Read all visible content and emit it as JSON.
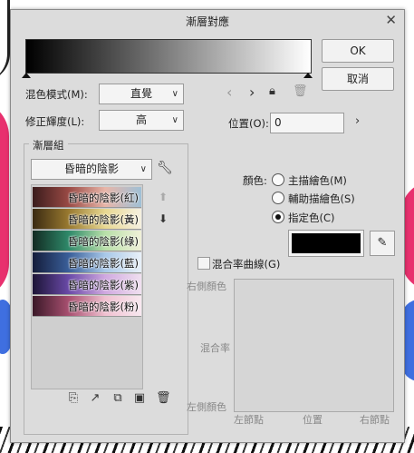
{
  "dialog": {
    "title": "漸層對應",
    "ok": "OK",
    "cancel": "取消"
  },
  "gradient": {
    "start_color": "#000000",
    "end_color": "#ffffff"
  },
  "blend_mode": {
    "label": "混色模式(M):",
    "value": "直覺"
  },
  "correction": {
    "label": "修正輝度(L):",
    "value": "高"
  },
  "position": {
    "label": "位置(O):",
    "value": "0"
  },
  "gradient_set": {
    "title": "漸層組",
    "selected": "昏暗的陰影",
    "items": [
      {
        "label": "昏暗的陰影(紅)",
        "colors": [
          "#3a1c1c",
          "#9a4a45",
          "#e8b5a8",
          "#9fc0d6"
        ]
      },
      {
        "label": "昏暗的陰影(黃)",
        "colors": [
          "#3a2a12",
          "#9a7a30",
          "#e8d890",
          "#f5f0e0"
        ]
      },
      {
        "label": "昏暗的陰影(綠)",
        "colors": [
          "#122a22",
          "#2f8a6a",
          "#b8e0a8",
          "#f0f0d8"
        ]
      },
      {
        "label": "昏暗的陰影(藍)",
        "colors": [
          "#141c3a",
          "#3a5f9a",
          "#a8c8e8",
          "#e8f0f8"
        ]
      },
      {
        "label": "昏暗的陰影(紫)",
        "colors": [
          "#1c1436",
          "#6a4aa8",
          "#d0a8e0",
          "#f0e0f0"
        ]
      },
      {
        "label": "昏暗的陰影(粉)",
        "colors": [
          "#3a1828",
          "#a85070",
          "#f0c0d0",
          "#f8e8f0"
        ]
      }
    ]
  },
  "color_section": {
    "label": "顏色:",
    "options": [
      "主描繪色(M)",
      "輔助描繪色(S)",
      "指定色(C)"
    ],
    "selected": 2,
    "swatch_color": "#000000"
  },
  "blend_curve": {
    "label": "混合率曲線(G)",
    "y_top": "右側顏色",
    "y_mid": "混合率",
    "y_bottom": "左側顏色",
    "x_left": "左節點",
    "x_mid": "位置",
    "x_right": "右節點"
  },
  "icons": {
    "close": "close-icon",
    "prev": "chevron-left-icon",
    "next": "chevron-right-icon",
    "lock": "lock-node-icon",
    "trash": "trash-icon",
    "wrench": "wrench-icon",
    "eyedropper": "eyedropper-icon"
  }
}
